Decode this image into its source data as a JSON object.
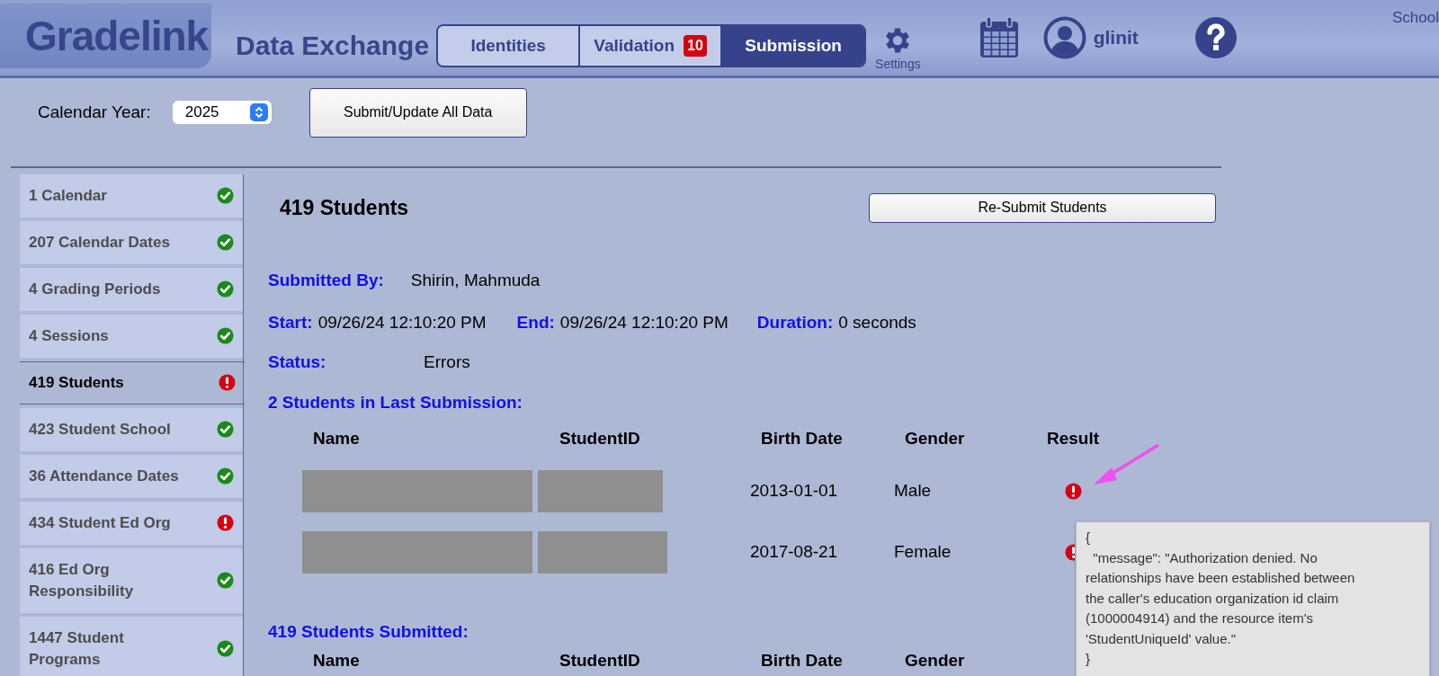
{
  "header": {
    "logo": "Gradelink",
    "title": "Data Exchange",
    "tabs": [
      {
        "label": "Identities",
        "selected": false
      },
      {
        "label": "Validation",
        "badge": "10",
        "selected": false
      },
      {
        "label": "Submission",
        "selected": true
      }
    ],
    "settings_label": "Settings",
    "user": "glinit",
    "corner_text": "School"
  },
  "toolbar": {
    "year_label": "Calendar Year:",
    "year_value": "2025",
    "submit_button": "Submit/Update All Data"
  },
  "sidebar": {
    "items": [
      {
        "label": "1 Calendar",
        "error": false,
        "selected": false
      },
      {
        "label": "207 Calendar Dates",
        "error": false,
        "selected": false
      },
      {
        "label": "4 Grading Periods",
        "error": false,
        "selected": false
      },
      {
        "label": "4 Sessions",
        "error": false,
        "selected": false
      },
      {
        "label": "419 Students",
        "error": true,
        "selected": true
      },
      {
        "label": "423 Student School",
        "error": false,
        "selected": false
      },
      {
        "label": "36 Attendance Dates",
        "error": false,
        "selected": false
      },
      {
        "label": "434 Student Ed Org",
        "error": true,
        "selected": false
      },
      {
        "label": "416 Ed Org Responsibility",
        "error": false,
        "selected": false
      },
      {
        "label": "1447 Student Programs",
        "error": false,
        "selected": false
      }
    ]
  },
  "main": {
    "title": "419 Students",
    "resubmit_button": "Re-Submit Students",
    "submitted_by_label": "Submitted By:",
    "submitted_by": "Shirin, Mahmuda",
    "start_label": "Start:",
    "start": "09/26/24 12:10:20 PM",
    "end_label": "End:",
    "end": "09/26/24 12:10:20 PM",
    "duration_label": "Duration:",
    "duration": "0 seconds",
    "status_label": "Status:",
    "status": "Errors",
    "last_heading": "2 Students in Last Submission:",
    "last_columns": [
      "Name",
      "StudentID",
      "Birth Date",
      "Gender",
      "Result"
    ],
    "last_rows": [
      {
        "birth_date": "2013-01-01",
        "gender": "Male",
        "error": true
      },
      {
        "birth_date": "2017-08-21",
        "gender": "Female",
        "error": true
      }
    ],
    "submitted_heading": "419 Students Submitted:",
    "submitted_columns": [
      "Name",
      "StudentID",
      "Birth Date",
      "Gender"
    ]
  },
  "tooltip": {
    "lines": [
      "{",
      "  \"message\": \"Authorization denied. No",
      "relationships have been established between",
      "the caller's education organization id claim",
      "(1000004914) and the resource item's",
      "'StudentUniqueId' value.\"",
      "}"
    ]
  }
}
